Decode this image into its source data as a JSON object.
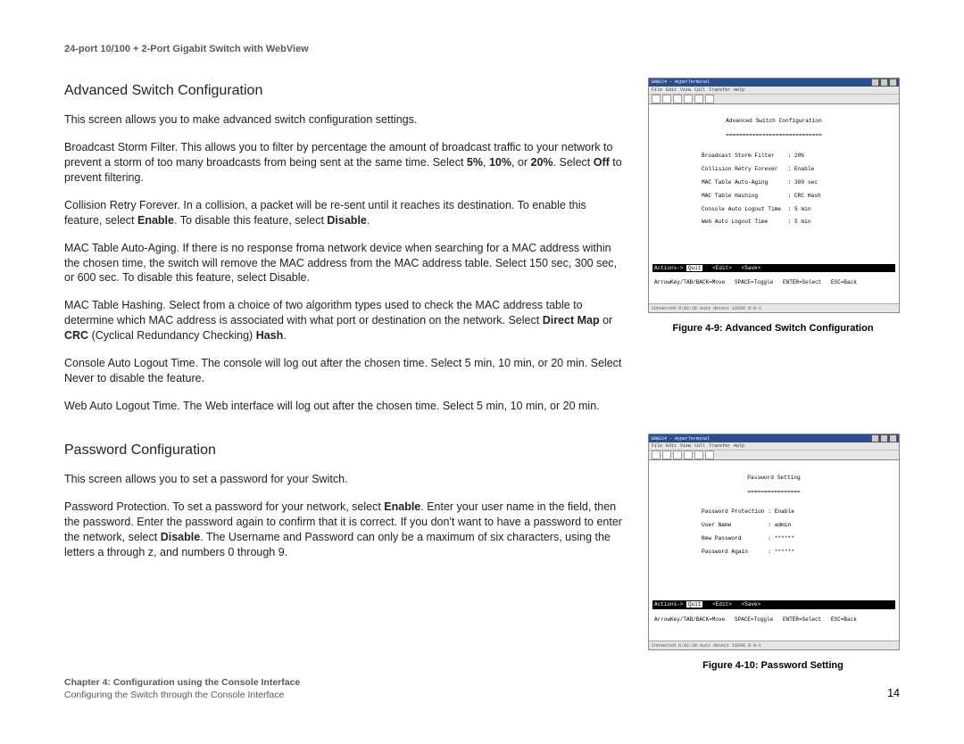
{
  "header": {
    "product_title": "24-port 10/100 + 2-Port Gigabit Switch with WebView"
  },
  "sections": {
    "advanced": {
      "heading": "Advanced Switch Configuration",
      "p1": "This screen allows you to make advanced switch configuration settings.",
      "p2_a": "Broadcast Storm Filter. This allows you to filter by percentage the amount of broadcast traffic to your network to prevent a storm of too many broadcasts from being sent at the same time. Select ",
      "p2_b1": "5%",
      "p2_c": ", ",
      "p2_b2": "10%",
      "p2_d": ", or ",
      "p2_b3": "20%",
      "p2_e": ". Select ",
      "p2_b4": "Off",
      "p2_f": " to prevent filtering.",
      "p3_a": "Collision Retry Forever. In a collision, a packet will be re-sent until it reaches its destination. To enable this feature, select ",
      "p3_b1": "Enable",
      "p3_c": ". To disable this feature, select ",
      "p3_b2": "Disable",
      "p3_d": ".",
      "p4": "MAC Table Auto-Aging. If there is no response froma network device when searching for a MAC address within the chosen time, the switch will remove the MAC address from the MAC address table. Select 150 sec, 300 sec, or 600 sec. To disable this feature, select Disable.",
      "p5_a": "MAC Table Hashing. Select from a choice of two algorithm types used to check the MAC address table to determine which MAC address is associated with what port or destination on the network. Select ",
      "p5_b1": "Direct Map",
      "p5_c": " or ",
      "p5_b2": "CRC",
      "p5_d": " (Cyclical Redundancy Checking) ",
      "p5_b3": "Hash",
      "p5_e": ".",
      "p6": "Console Auto Logout Time. The console will log out after the chosen time. Select 5 min, 10 min, or 20 min. Select Never to disable the feature.",
      "p7": "Web Auto Logout Time. The Web interface will log out after the chosen time. Select 5 min, 10 min, or 20 min."
    },
    "password": {
      "heading": "Password Configuration",
      "p1": "This screen allows you to set a password for your Switch.",
      "p2_a": "Password Protection. To set a password for your network, select ",
      "p2_b1": "Enable",
      "p2_c": ". Enter your user name in the field, then the password. Enter the password again to confirm that it is correct. If you don't want to have a password to enter the network, select ",
      "p2_b2": "Disable",
      "p2_d": ". The Username and Password can only be a maximum of six characters, using the letters a through z, and numbers 0 through 9."
    }
  },
  "figures": {
    "fig1": {
      "caption": "Figure 4-9: Advanced Switch Configuration",
      "window_title": "SRW224 - HyperTerminal",
      "term_title": "Advanced Switch Configuration",
      "rows": [
        "Broadcast Storm Filter    : 20%",
        "Collision Retry Forever   : Enable",
        "MAC Table Auto-Aging      : 300 sec",
        "MAC Table Hashing         : CRC Hash",
        "Console Auto Logout Time  : 5 min",
        "Web Auto Logout Time      : 5 min"
      ],
      "action_quit": "Quit",
      "action_edit": "<Edit>",
      "action_save": "<Save>",
      "hint": "ArrowKey/TAB/BACK=Move   SPACE=Toggle   ENTER=Select   ESC=Back",
      "status": "Connected 0:02:39   Auto detect   19200 8-N-1"
    },
    "fig2": {
      "caption": "Figure 4-10: Password Setting",
      "window_title": "SRW224 - HyperTerminal",
      "term_title": "Password Setting",
      "rows": [
        "Password Protection : Enable",
        "User Name           : admin",
        "New Password        : ******",
        "Password Again      : ******"
      ],
      "action_quit": "Quit",
      "action_edit": "<Edit>",
      "action_save": "<Save>",
      "hint": "ArrowKey/TAB/BACK=Move   SPACE=Toggle   ENTER=Select   ESC=Back",
      "status": "Connected 0:02:39   Auto detect   19200 8-N-1"
    }
  },
  "footer": {
    "chapter": "Chapter 4: Configuration using the Console Interface",
    "subsection": "Configuring the Switch through the Console Interface",
    "page_number": "14"
  },
  "menu_items": [
    "File",
    "Edit",
    "View",
    "Call",
    "Transfer",
    "Help"
  ]
}
